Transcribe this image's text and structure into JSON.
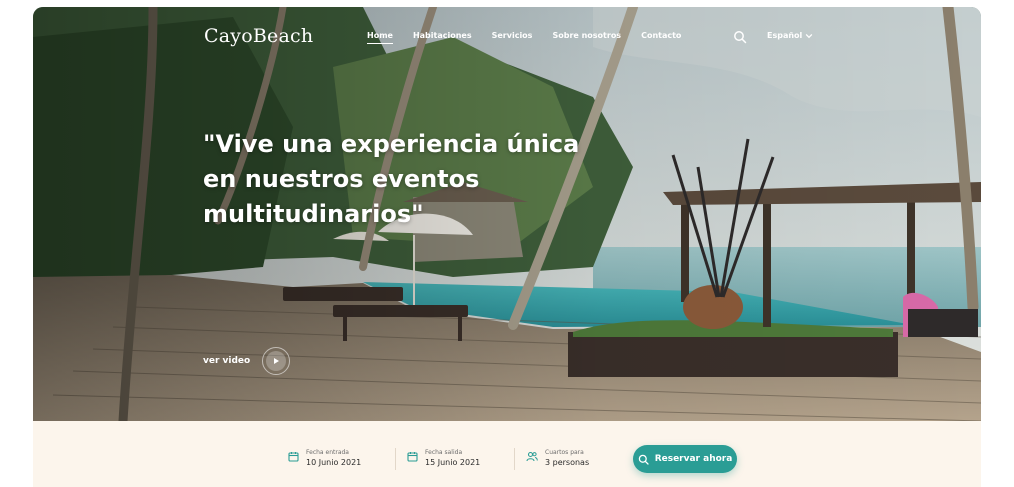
{
  "brand": {
    "name": "CayoBeach"
  },
  "nav": {
    "links": [
      {
        "label": "Home"
      },
      {
        "label": "Habitaciones"
      },
      {
        "label": "Servicios"
      },
      {
        "label": "Sobre nosotros"
      },
      {
        "label": "Contacto"
      }
    ],
    "active_index": 0,
    "language": "Español"
  },
  "hero": {
    "headline": "\"Vive una experiencia única en nuestros eventos multitudinarios\"",
    "video_label": "ver video"
  },
  "booking": {
    "check_in": {
      "label": "Fecha entrada",
      "value": "10 Junio 2021"
    },
    "check_out": {
      "label": "Fecha salida",
      "value": "15 Junio 2021"
    },
    "rooms": {
      "label": "Cuartos para",
      "value": "3 personas"
    },
    "cta_label": "Reservar ahora"
  },
  "colors": {
    "accent": "#2a9d95",
    "booking_bg": "#fcf5ec"
  },
  "icons": {
    "search": "search-icon",
    "language_dropdown": "chevron-down-icon",
    "play": "play-icon",
    "calendar": "calendar-icon",
    "people": "people-icon"
  }
}
